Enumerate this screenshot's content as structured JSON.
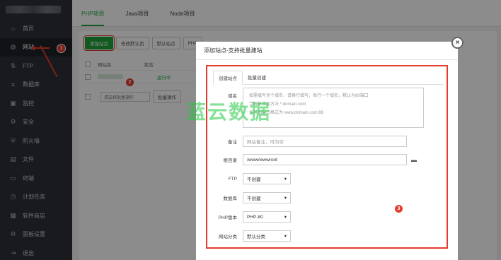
{
  "sidebar": {
    "items": [
      {
        "icon": "home-icon",
        "glyph": "⌂",
        "label": "首页"
      },
      {
        "icon": "globe-icon",
        "glyph": "◍",
        "label": "网站"
      },
      {
        "icon": "ftp-icon",
        "glyph": "⇅",
        "label": "FTP"
      },
      {
        "icon": "database-icon",
        "glyph": "≡",
        "label": "数据库"
      },
      {
        "icon": "monitor-icon",
        "glyph": "▣",
        "label": "监控"
      },
      {
        "icon": "security-icon",
        "glyph": "⚙",
        "label": "安全"
      },
      {
        "icon": "firewall-icon",
        "glyph": "⛨",
        "label": "防火墙"
      },
      {
        "icon": "file-icon",
        "glyph": "▤",
        "label": "文件"
      },
      {
        "icon": "terminal-icon",
        "glyph": "▭",
        "label": "终端"
      },
      {
        "icon": "cron-icon",
        "glyph": "◷",
        "label": "计划任务"
      },
      {
        "icon": "store-icon",
        "glyph": "▦",
        "label": "软件商店"
      },
      {
        "icon": "settings-icon",
        "glyph": "⚙",
        "label": "面板设置"
      },
      {
        "icon": "logout-icon",
        "glyph": "⇥",
        "label": "退出"
      }
    ],
    "active_index": 1
  },
  "tabs": [
    "PHP项目",
    "Java项目",
    "Node项目"
  ],
  "toolbar": {
    "add_site": "添加站点",
    "edit_default": "修改默认页",
    "default_site": "默认站点",
    "php": "PHP"
  },
  "table": {
    "header_name": "网站名",
    "header_status": "状态",
    "row_status": "运行中",
    "batch_select": "请选择批量操作",
    "batch_action": "批量操作"
  },
  "dialog": {
    "title": "添加站点-支持批量建站",
    "tab_create": "创建站点",
    "tab_batch": "批量创建",
    "domain_label": "域名",
    "domain_placeholder_lines": [
      "如需填写多个域名，请换行填写，每行一个域名，默认为80端口",
      "泛解析添加方法 *.domain.com",
      "如另加端口格式为 www.domain.com:88"
    ],
    "remark_label": "备注",
    "remark_placeholder": "网站备注，可为空",
    "root_label": "根目录",
    "root_value": "/www/wwwroot",
    "ftp_label": "FTP",
    "ftp_value": "不创建",
    "db_label": "数据库",
    "db_value": "不创建",
    "php_label": "PHP版本",
    "php_value": "PHP-80",
    "category_label": "网站分类",
    "category_value": "默认分类"
  },
  "annotations": {
    "step1": "1",
    "step2": "2",
    "step3": "3"
  },
  "watermark": "蓝云数据",
  "colors": {
    "accent": "#20a53a",
    "annotation": "#e33d2f",
    "sidebar": "#2c3038"
  }
}
